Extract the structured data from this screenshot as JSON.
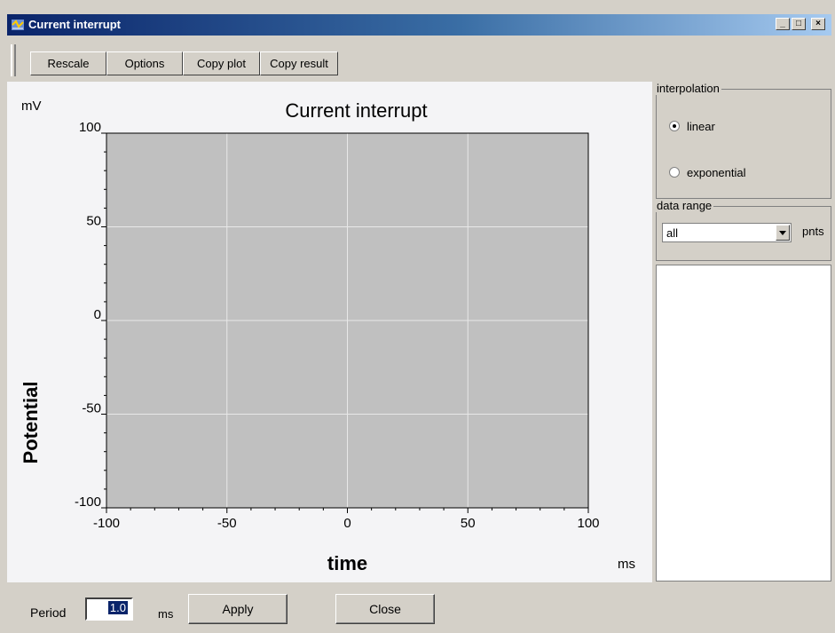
{
  "window": {
    "title": "Current interrupt",
    "minimize_symbol": "_",
    "maximize_symbol": "□",
    "close_symbol": "×"
  },
  "toolbar": {
    "rescale_label": "Rescale",
    "options_label": "Options",
    "copy_plot_label": "Copy plot",
    "copy_result_label": "Copy result"
  },
  "interpolation": {
    "group_label": "interpolation",
    "options": [
      "linear",
      "exponential"
    ],
    "selected": "linear"
  },
  "data_range": {
    "group_label": "data range",
    "selected": "all",
    "unit": "pnts"
  },
  "bottom": {
    "period_label": "Period",
    "period_value": "1.0",
    "period_unit": "ms",
    "apply_label": "Apply",
    "close_label": "Close"
  },
  "chart_data": {
    "type": "line",
    "title": "Current interrupt",
    "xlabel": "time",
    "ylabel": "Potential",
    "x_unit": "ms",
    "y_unit": "mV",
    "xlim": [
      -100,
      100
    ],
    "ylim": [
      -100,
      100
    ],
    "x_ticks": [
      -100,
      -50,
      0,
      50,
      100
    ],
    "y_ticks": [
      100,
      50,
      0,
      -50,
      -100
    ],
    "grid": true,
    "series": [],
    "plot_bg": "#c0c0c0",
    "grid_color": "#e8e8e8"
  },
  "colors": {
    "face": "#d4d0c8",
    "title_start": "#0a246a",
    "title_end": "#a6caf0"
  }
}
